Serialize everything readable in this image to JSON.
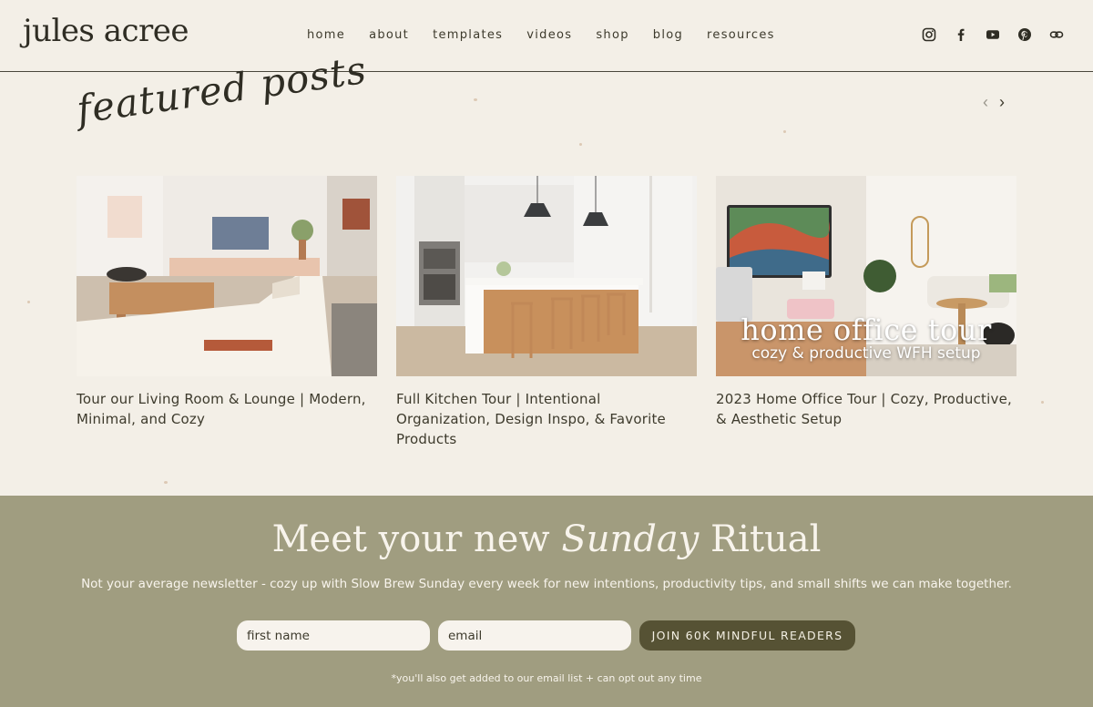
{
  "brand": {
    "logo": "jules acree"
  },
  "nav": [
    "home",
    "about",
    "templates",
    "videos",
    "shop",
    "blog",
    "resources"
  ],
  "social": [
    "instagram-icon",
    "facebook-icon",
    "youtube-icon",
    "pinterest-icon",
    "link-icon"
  ],
  "featured": {
    "heading": "featured posts",
    "prev_arrow": "‹",
    "next_arrow": "›",
    "posts": [
      {
        "title": "Tour our Living Room & Lounge | Modern, Minimal, and Cozy"
      },
      {
        "title": "Full Kitchen Tour | Intentional Organization, Design Inspo, & Favorite Products"
      },
      {
        "title": "2023 Home Office Tour | Cozy, Productive, & Aesthetic Setup",
        "overlay_title": "home office tour",
        "overlay_subtitle": "cozy & productive WFH setup"
      }
    ]
  },
  "newsletter": {
    "headline_start": "Meet your new",
    "headline_script": "Sunday",
    "headline_end": "Ritual",
    "description": "Not your average newsletter - cozy up with Slow Brew Sunday every week for new intentions, productivity tips, and small shifts we can make together.",
    "first_name_placeholder": "first name",
    "email_placeholder": "email",
    "button_label": "JOIN 60K MINDFUL READERS",
    "footnote": "*you'll also get added to our email list + can opt out any time"
  },
  "colors": {
    "background": "#f3efe7",
    "newsletter_bg": "#a09d80",
    "button_bg": "#565234",
    "text": "#3d3a2c"
  }
}
